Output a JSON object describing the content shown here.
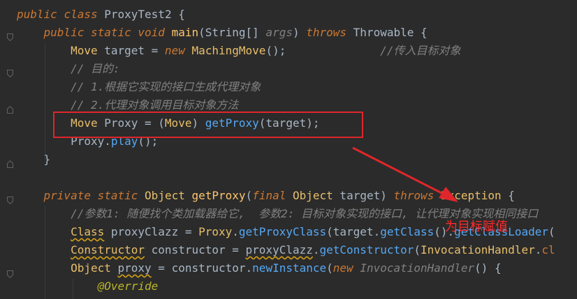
{
  "editor": {
    "lines": [
      {
        "tokens": [
          [
            "kw",
            "public"
          ],
          [
            "p",
            " "
          ],
          [
            "kw",
            "class"
          ],
          [
            "p",
            " ProxyTest2 {"
          ]
        ]
      },
      {
        "tokens": [
          [
            "p",
            "    "
          ],
          [
            "kw",
            "public"
          ],
          [
            "p",
            " "
          ],
          [
            "kw",
            "static"
          ],
          [
            "p",
            " "
          ],
          [
            "kw",
            "void"
          ],
          [
            "p",
            " "
          ],
          [
            "fn",
            "main"
          ],
          [
            "p",
            "(String[] "
          ],
          [
            "cm",
            "args"
          ],
          [
            "p",
            ") "
          ],
          [
            "kw",
            "throws"
          ],
          [
            "p",
            " Throwable {"
          ]
        ]
      },
      {
        "tokens": [
          [
            "p",
            "        "
          ],
          [
            "type",
            "Move"
          ],
          [
            "p",
            " target = "
          ],
          [
            "kw",
            "new"
          ],
          [
            "p",
            " "
          ],
          [
            "type",
            "MachingMove"
          ],
          [
            "p",
            "();"
          ],
          [
            "p",
            "              "
          ],
          [
            "cm",
            "//传入目标对象"
          ]
        ]
      },
      {
        "tokens": [
          [
            "p",
            "        "
          ],
          [
            "cm",
            "// 目的:"
          ]
        ]
      },
      {
        "tokens": [
          [
            "p",
            "        "
          ],
          [
            "cm",
            "// 1.根据它实现的接口生成代理对象"
          ]
        ]
      },
      {
        "tokens": [
          [
            "p",
            "        "
          ],
          [
            "cm",
            "// 2.代理对象调用目标对象方法"
          ]
        ]
      },
      {
        "tokens": [
          [
            "p",
            "        "
          ],
          [
            "type",
            "Move"
          ],
          [
            "p",
            " Proxy = ("
          ],
          [
            "type",
            "Move"
          ],
          [
            "p",
            ") "
          ],
          [
            "call",
            "getProxy"
          ],
          [
            "p",
            "(target);"
          ]
        ]
      },
      {
        "tokens": [
          [
            "p",
            "        Proxy."
          ],
          [
            "call",
            "play"
          ],
          [
            "p",
            "();"
          ]
        ]
      },
      {
        "tokens": [
          [
            "p",
            "    }"
          ]
        ]
      },
      {
        "tokens": [
          [
            "p",
            ""
          ]
        ]
      },
      {
        "tokens": [
          [
            "p",
            "    "
          ],
          [
            "kw",
            "private"
          ],
          [
            "p",
            " "
          ],
          [
            "kw",
            "static"
          ],
          [
            "p",
            " "
          ],
          [
            "type",
            "Object"
          ],
          [
            "p",
            " "
          ],
          [
            "fn",
            "getProxy"
          ],
          [
            "p",
            "("
          ],
          [
            "kw",
            "final"
          ],
          [
            "p",
            " "
          ],
          [
            "type",
            "Object"
          ],
          [
            "p",
            " target) "
          ],
          [
            "kw",
            "throws"
          ],
          [
            "p",
            " "
          ],
          [
            "type",
            "Exception"
          ],
          [
            "p",
            " {"
          ]
        ]
      },
      {
        "tokens": [
          [
            "p",
            "        "
          ],
          [
            "cm",
            "//参数1: 随便找个类加载器给它,  参数2: 目标对象实现的接口, 让代理对象实现相同接口"
          ]
        ]
      },
      {
        "tokens": [
          [
            "p",
            "        "
          ],
          [
            "sq",
            "Class"
          ],
          [
            "p",
            " proxyClazz = "
          ],
          [
            "type",
            "Proxy"
          ],
          [
            "p",
            "."
          ],
          [
            "call",
            "getProxyClass"
          ],
          [
            "p",
            "(target."
          ],
          [
            "call",
            "getClass"
          ],
          [
            "p",
            "()."
          ],
          [
            "call",
            "getClassLoader"
          ],
          [
            "p",
            "("
          ]
        ]
      },
      {
        "tokens": [
          [
            "p",
            "        "
          ],
          [
            "sq",
            "Constructor"
          ],
          [
            "p",
            " constructor = "
          ],
          [
            "sqp",
            "proxyClazz"
          ],
          [
            "p",
            "."
          ],
          [
            "call",
            "getConstructor"
          ],
          [
            "p",
            "("
          ],
          [
            "type",
            "InvocationHandler"
          ],
          [
            "p",
            "."
          ],
          [
            "kwn",
            "cl"
          ]
        ]
      },
      {
        "tokens": [
          [
            "p",
            "        "
          ],
          [
            "type",
            "Object"
          ],
          [
            "p",
            " "
          ],
          [
            "sqp",
            "proxy"
          ],
          [
            "p",
            " = constructor."
          ],
          [
            "call",
            "newInstance"
          ],
          [
            "p",
            "("
          ],
          [
            "kw",
            "new"
          ],
          [
            "p",
            " "
          ],
          [
            "cm2",
            "InvocationHandler"
          ],
          [
            "p",
            "() {"
          ]
        ]
      },
      {
        "tokens": [
          [
            "p",
            "            "
          ],
          [
            "ann",
            "@Override"
          ]
        ]
      }
    ]
  },
  "annotation": {
    "label": "为目标赋值",
    "color": "#e0262b"
  }
}
